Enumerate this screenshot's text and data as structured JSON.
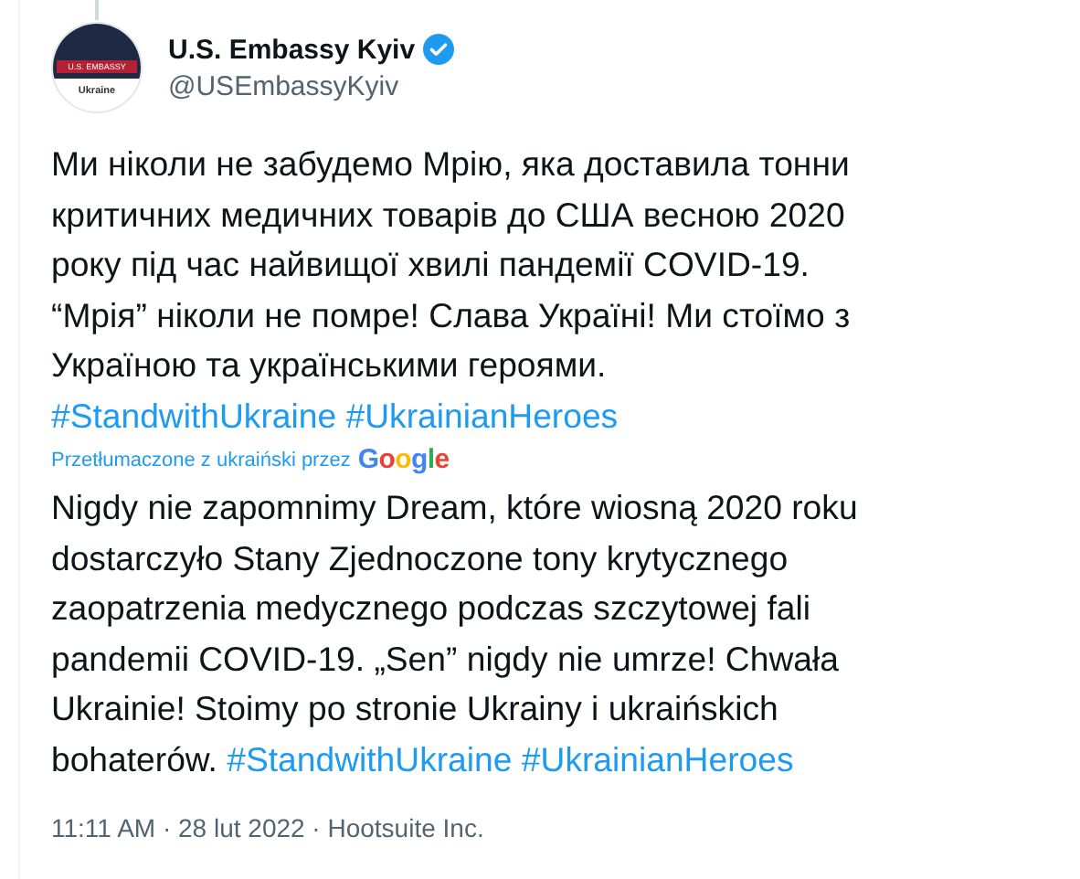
{
  "author": {
    "name": "U.S. Embassy Kyiv",
    "verified": true,
    "handle": "@USEmbassyKyiv",
    "avatar_label": "U.S. EMBASSY",
    "avatar_caption": "Ukraine"
  },
  "original_text": [
    {
      "kind": "text",
      "text": "Ми ніколи не забудемо Мрію, яка доставила тонни\nкритичних медичних товарів до США весною 2020\nроку під час найвищої хвилі пандемії COVID-19.\n“Мрія” ніколи не помре! Слава Україні! Ми стоїмо з\nУкраїною та українськими героями.\n"
    },
    {
      "kind": "hashtag",
      "text": "#StandwithUkraine"
    },
    {
      "kind": "hashtag",
      "text": "#UkrainianHeroes"
    }
  ],
  "translation": {
    "note": "Przetłumaczone z ukraiński przez",
    "provider": "Google"
  },
  "translated_text": [
    {
      "kind": "text",
      "text": "Nigdy nie zapomnimy Dream, które wiosną 2020 roku\ndostarczyło Stany Zjednoczone tony krytycznego\nzaopatrzenia medycznego podczas szczytowej fali\npandemii COVID-19. „Sen” nigdy nie umrze! Chwała\nUkrainie! Stoimy po stronie Ukrainy i ukraińskich\nbohaterów. "
    },
    {
      "kind": "hashtag",
      "text": "#StandwithUkraine"
    },
    {
      "kind": "hashtag",
      "text": "#UkrainianHeroes"
    }
  ],
  "meta": "11:11 AM · 28 lut 2022 · Hootsuite Inc."
}
